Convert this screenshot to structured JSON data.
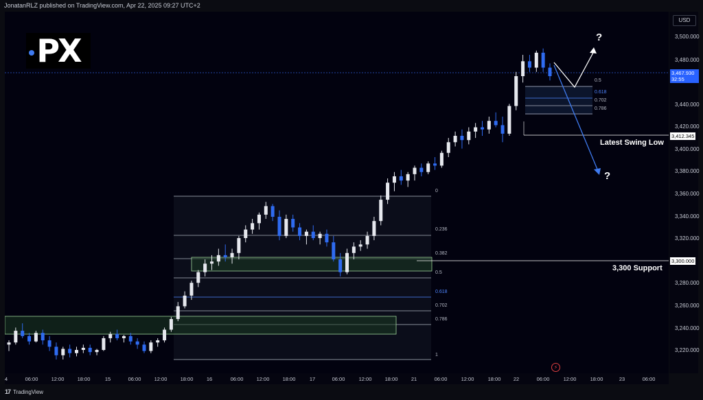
{
  "header": {
    "published_text": "JonatanRLZ published on TradingView.com, Apr 22, 2025 09:27 UTC+2"
  },
  "logo": {
    "text": "PX"
  },
  "price_axis": {
    "currency": "USD",
    "ticks": [
      "3,500.000",
      "3,480.000",
      "3,440.000",
      "3,420.000",
      "3,400.000",
      "3,380.000",
      "3,360.000",
      "3,340.000",
      "3,320.000",
      "3,280.000",
      "3,260.000",
      "3,240.000",
      "3,220.000"
    ],
    "current_price": "3,467.930",
    "countdown": "32:55",
    "swing_low_price": "3,412.345",
    "support_price": "3,300.000"
  },
  "time_axis": {
    "ticks": [
      "4",
      "06:00",
      "12:00",
      "18:00",
      "15",
      "06:00",
      "12:00",
      "18:00",
      "16",
      "06:00",
      "12:00",
      "18:00",
      "17",
      "06:00",
      "12:00",
      "18:00",
      "21",
      "06:00",
      "12:00",
      "18:00",
      "22",
      "06:00",
      "12:00",
      "18:00",
      "23",
      "06:00"
    ]
  },
  "fib_upper": {
    "levels": [
      "0.5",
      "0.618",
      "0.702",
      "0.786"
    ]
  },
  "fib_lower": {
    "levels": [
      "0",
      "0.236",
      "0.382",
      "0.5",
      "0.618",
      "0.702",
      "0.786",
      "1"
    ]
  },
  "annotations": {
    "swing_low": "Latest Swing Low",
    "support": "3,300 Support",
    "question_up": "?",
    "question_down": "?"
  },
  "footer": {
    "brand": "TradingView",
    "brand_mark": "17"
  },
  "colors": {
    "bull": "#e6e8ee",
    "bear": "#2f6bf0",
    "zone": "#9fd49a",
    "accent": "#2962ff"
  },
  "chart_data": {
    "type": "candlestick",
    "symbol_unit": "USD",
    "ylim": [
      3208,
      3512
    ],
    "candles": [
      [
        3222,
        3226,
        3216,
        3224
      ],
      [
        3224,
        3238,
        3222,
        3235
      ],
      [
        3235,
        3242,
        3228,
        3230
      ],
      [
        3230,
        3233,
        3222,
        3225
      ],
      [
        3225,
        3235,
        3224,
        3233
      ],
      [
        3233,
        3236,
        3222,
        3226
      ],
      [
        3226,
        3230,
        3216,
        3220
      ],
      [
        3220,
        3224,
        3208,
        3212
      ],
      [
        3212,
        3220,
        3208,
        3218
      ],
      [
        3218,
        3222,
        3210,
        3214
      ],
      [
        3214,
        3220,
        3211,
        3217
      ],
      [
        3217,
        3222,
        3214,
        3219
      ],
      [
        3219,
        3222,
        3212,
        3215
      ],
      [
        3215,
        3218,
        3212,
        3217
      ],
      [
        3217,
        3230,
        3216,
        3228
      ],
      [
        3228,
        3234,
        3224,
        3232
      ],
      [
        3232,
        3236,
        3226,
        3228
      ],
      [
        3228,
        3231,
        3224,
        3230
      ],
      [
        3230,
        3233,
        3222,
        3225
      ],
      [
        3225,
        3228,
        3218,
        3222
      ],
      [
        3222,
        3225,
        3214,
        3216
      ],
      [
        3216,
        3226,
        3214,
        3224
      ],
      [
        3224,
        3228,
        3220,
        3226
      ],
      [
        3226,
        3238,
        3224,
        3236
      ],
      [
        3236,
        3248,
        3234,
        3246
      ],
      [
        3246,
        3262,
        3244,
        3258
      ],
      [
        3258,
        3272,
        3256,
        3268
      ],
      [
        3268,
        3282,
        3264,
        3280
      ],
      [
        3280,
        3292,
        3276,
        3290
      ],
      [
        3290,
        3302,
        3286,
        3298
      ],
      [
        3298,
        3306,
        3292,
        3300
      ],
      [
        3300,
        3312,
        3296,
        3306
      ],
      [
        3306,
        3316,
        3300,
        3304
      ],
      [
        3304,
        3312,
        3298,
        3308
      ],
      [
        3308,
        3324,
        3302,
        3322
      ],
      [
        3322,
        3334,
        3318,
        3330
      ],
      [
        3330,
        3340,
        3326,
        3336
      ],
      [
        3336,
        3346,
        3330,
        3344
      ],
      [
        3344,
        3356,
        3340,
        3352
      ],
      [
        3352,
        3354,
        3338,
        3342
      ],
      [
        3342,
        3348,
        3320,
        3324
      ],
      [
        3324,
        3344,
        3322,
        3340
      ],
      [
        3340,
        3344,
        3328,
        3332
      ],
      [
        3332,
        3336,
        3320,
        3324
      ],
      [
        3324,
        3330,
        3316,
        3328
      ],
      [
        3328,
        3334,
        3320,
        3322
      ],
      [
        3322,
        3328,
        3316,
        3326
      ],
      [
        3326,
        3330,
        3314,
        3318
      ],
      [
        3318,
        3324,
        3300,
        3302
      ],
      [
        3302,
        3308,
        3286,
        3290
      ],
      [
        3290,
        3312,
        3288,
        3308
      ],
      [
        3308,
        3318,
        3302,
        3314
      ],
      [
        3314,
        3320,
        3310,
        3316
      ],
      [
        3316,
        3328,
        3312,
        3324
      ],
      [
        3324,
        3342,
        3320,
        3338
      ],
      [
        3338,
        3362,
        3334,
        3358
      ],
      [
        3358,
        3378,
        3354,
        3374
      ],
      [
        3374,
        3384,
        3366,
        3380
      ],
      [
        3380,
        3386,
        3372,
        3376
      ],
      [
        3376,
        3384,
        3370,
        3382
      ],
      [
        3382,
        3390,
        3376,
        3388
      ],
      [
        3388,
        3392,
        3380,
        3384
      ],
      [
        3384,
        3394,
        3382,
        3392
      ],
      [
        3392,
        3398,
        3386,
        3390
      ],
      [
        3390,
        3404,
        3388,
        3402
      ],
      [
        3402,
        3416,
        3398,
        3412
      ],
      [
        3412,
        3422,
        3408,
        3418
      ],
      [
        3418,
        3424,
        3406,
        3414
      ],
      [
        3414,
        3426,
        3410,
        3422
      ],
      [
        3422,
        3430,
        3416,
        3426
      ],
      [
        3426,
        3432,
        3418,
        3424
      ],
      [
        3424,
        3436,
        3420,
        3432
      ],
      [
        3432,
        3440,
        3426,
        3428
      ],
      [
        3428,
        3436,
        3412,
        3420
      ],
      [
        3420,
        3448,
        3418,
        3446
      ],
      [
        3446,
        3478,
        3442,
        3474
      ],
      [
        3474,
        3494,
        3468,
        3488
      ],
      [
        3488,
        3494,
        3478,
        3482
      ],
      [
        3482,
        3498,
        3478,
        3496
      ],
      [
        3496,
        3500,
        3478,
        3482
      ],
      [
        3482,
        3486,
        3470,
        3474
      ]
    ]
  }
}
